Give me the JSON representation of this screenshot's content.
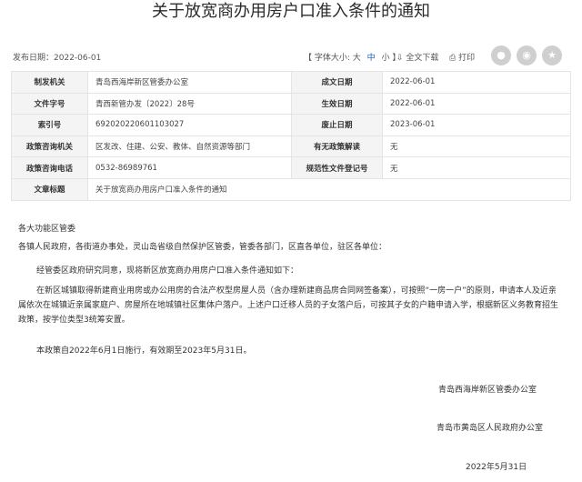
{
  "page": {
    "title": "关于放宽商办用房户口准入条件的通知"
  },
  "toolbar": {
    "publish_label": "发布日期：",
    "publish_date": "2022-06-01",
    "font_size_label": "【 字体大小: 大",
    "font_mid": "中",
    "font_small": "小 】",
    "fulltext_label": "全文下载",
    "print_label": "打印"
  },
  "share": {
    "icons": [
      "wechat-icon",
      "weibo-icon",
      "qq-icon"
    ]
  },
  "info_table": {
    "rows": [
      {
        "l1": "制发机关",
        "v1": "青岛西海岸新区管委办公室",
        "l2": "成文日期",
        "v2": "2022-06-01"
      },
      {
        "l1": "文件字号",
        "v1": "青西新管办发〔2022〕28号",
        "l2": "生效日期",
        "v2": "2022-06-01"
      },
      {
        "l1": "索引号",
        "v1": "692020220601103027",
        "l2": "废止日期",
        "v2": "2023-06-01"
      },
      {
        "l1": "政策咨询机关",
        "v1": "区发改、住建、公安、教体、自然资源等部门",
        "l2": "有无政策解读",
        "v2": "无"
      },
      {
        "l1": "政策咨询电话",
        "v1": "0532-86989761",
        "l2": "规范性文件登记号",
        "v2": "无"
      }
    ],
    "subject_label": "文章标题",
    "subject_value": "关于放宽商办用房户口准入条件的通知"
  },
  "body": {
    "greet1": "各大功能区管委",
    "greet2": "各镇人民政府，各街道办事处，灵山岛省级自然保护区管委，管委各部门，区直各单位，驻区各单位：",
    "para1": "经管委区政府研究同意，现将新区放宽商办用房户口准入条件通知如下：",
    "para2": "在新区城镇取得新建商业用房或办公用房的合法产权型房屋人员（含办理新建商品房合同网签备案），可按照“一房一户”的原则，申请本人及近亲属依次在城镇近亲属家庭户、房屋所在地城镇社区集体户落户。上述户口迁移人员的子女落户后，可按其子女的户籍申请入学，根据新区义务教育招生政策，按学位类型3统筹安置。",
    "para3": "本政策自2022年6月1日施行，有效期至2023年5月31日。"
  },
  "signature": {
    "org1": "青岛西海岸新区管委办公室",
    "org2": "青岛市黄岛区人民政府办公室",
    "date": "2022年5月31日"
  }
}
